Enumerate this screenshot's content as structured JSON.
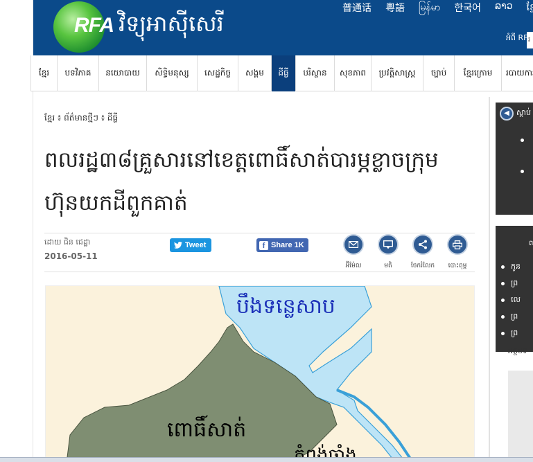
{
  "header": {
    "logo_text": "RFA",
    "site_title": "វិទ្យុអាស៊ីសេរី",
    "languages": [
      "普通话",
      "粵語",
      "မြန်မာ",
      "한국어",
      "ລາວ",
      "ខ្មែរ"
    ],
    "about_label": "អំពី RFA",
    "search_placeholder": "រ"
  },
  "nav": {
    "items": [
      "ខ្មែរ",
      "បទវិភាគ",
      "នយោបាយ",
      "សិទ្ធិមនុស្ស",
      "សេដ្ឋកិច្ច",
      "សង្គម",
      "ដីធ្លី",
      "បរិស្ថាន",
      "សុខភាព",
      "ប្រវត្តិសាស្ត្រ",
      "ច្បាប់",
      "ខ្មែរក្រោម",
      "របាយការណ៍"
    ],
    "active_index": 6
  },
  "article": {
    "breadcrumb": "ខ្មែរ ៖ ព័ត៌មានថ្មីៗ ៖ ដីធ្លី",
    "headline": "ពលរដ្ឋ៣៨គ្រួសារនៅខេត្តពោធិ៍សាត់បារម្ភខ្លាចក្រុមហ៊ុនយកដីពួកគាត់",
    "author": "ដោយ ជិន ជេដ្ឋា",
    "date": "2016-05-11",
    "tweet_label": "Tweet",
    "share_label": "Share 1K",
    "tools": [
      {
        "label": "អ៊ីម៉ែល",
        "icon": "envelope-icon"
      },
      {
        "label": "មតិ",
        "icon": "comment-icon"
      },
      {
        "label": "ចែករំលែក",
        "icon": "share-icon"
      },
      {
        "label": "បោះពុម្ព",
        "icon": "printer-icon"
      }
    ]
  },
  "map": {
    "lake_label": "បឹងទន្លេសាប",
    "province_label": "ពោធិ៍សាត់",
    "neighbor_label": "កំពង់ឆ្នាំង"
  },
  "sidebar": {
    "listen_label": "ស្តាប់",
    "box2_top": "ព",
    "box2_items": [
      "កូន",
      "ព្រ",
      "លេ",
      "ព្រ",
      "ព្រ"
    ],
    "archive_label": "អត្ថបទ"
  },
  "colors": {
    "header_blue": "#0b4a8a",
    "nav_active": "#0b3f7c",
    "twitter": "#1b95e0",
    "facebook": "#4267b2",
    "map_land": "#7f8e72",
    "map_water": "#bfe3f5"
  }
}
